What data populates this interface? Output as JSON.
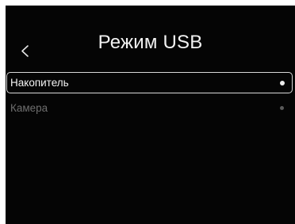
{
  "header": {
    "title": "Режим USB",
    "back_icon": "chevron-left-icon"
  },
  "options": [
    {
      "label": "Накопитель",
      "selected": true
    },
    {
      "label": "Камера",
      "selected": false
    }
  ],
  "colors": {
    "background": "#050505",
    "text_primary": "#f2f2f2",
    "text_dim": "#6e6e6e",
    "selection_border": "#d9d9d9"
  }
}
